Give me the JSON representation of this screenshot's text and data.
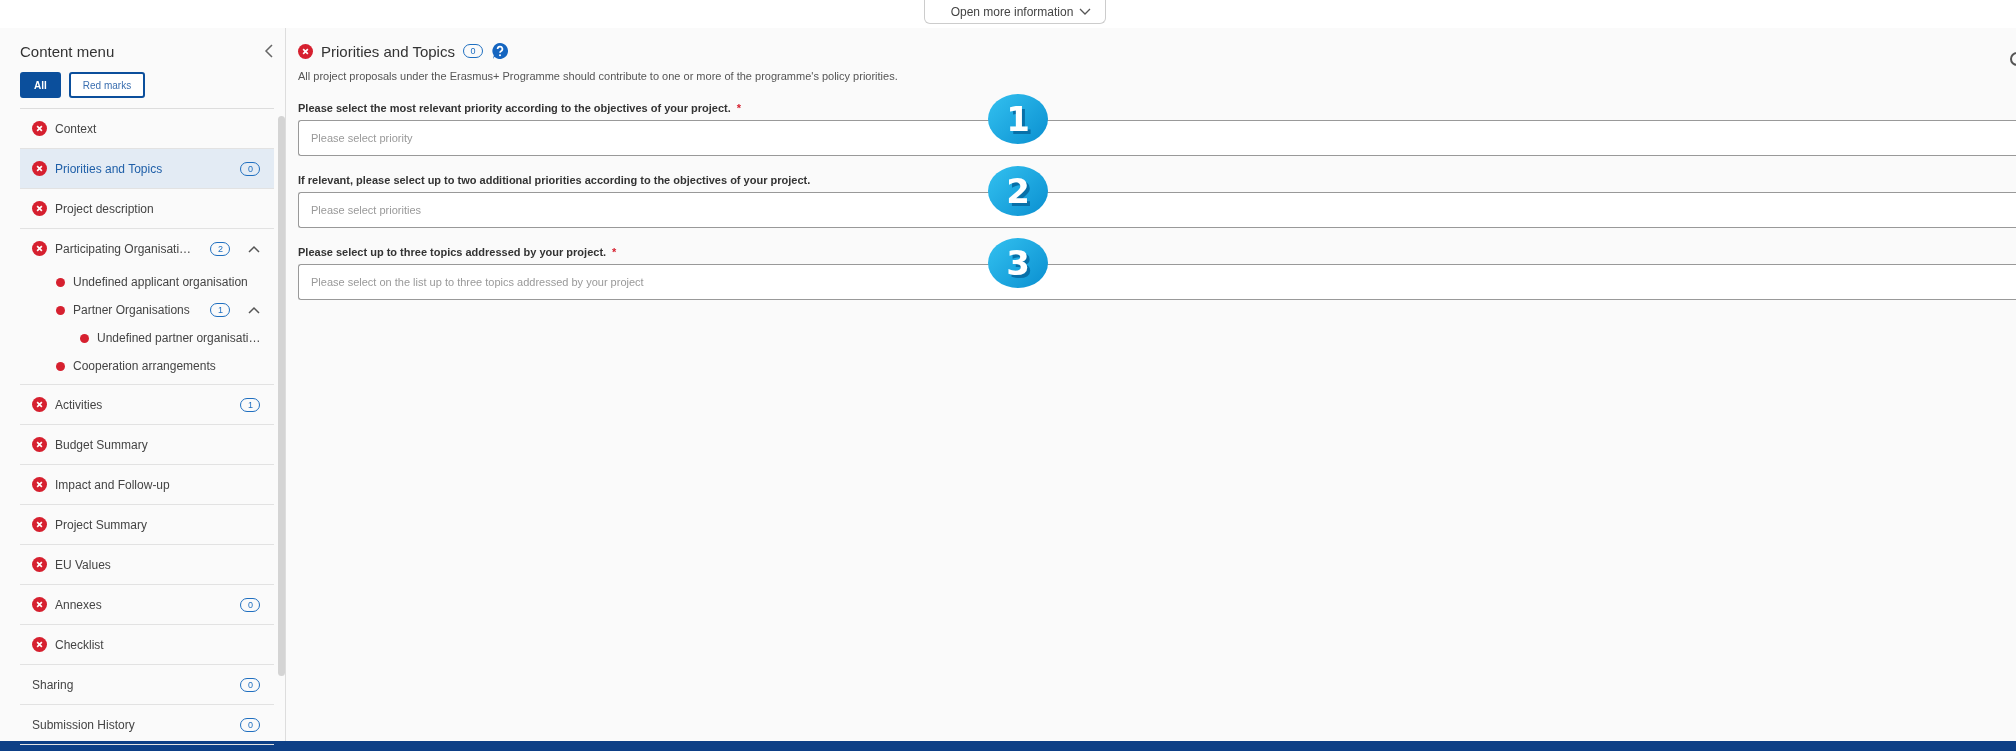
{
  "info_toggle": {
    "label": "Open more information",
    "expanded": false
  },
  "sidebar": {
    "title": "Content menu",
    "filters": [
      {
        "label": "All",
        "selected": true
      },
      {
        "label": "Red marks",
        "selected": false
      }
    ],
    "items": [
      {
        "label": "Context",
        "error": true,
        "selected": false
      },
      {
        "label": "Priorities and Topics",
        "error": true,
        "selected": true,
        "count": "0"
      },
      {
        "label": "Project description",
        "error": true,
        "selected": false
      },
      {
        "label": "Participating Organisati…",
        "error": true,
        "selected": false,
        "count": "2",
        "expanded": true,
        "children": [
          {
            "label": "Undefined applicant organisation",
            "error": true,
            "selected": false
          },
          {
            "label": "Partner Organisations",
            "error": true,
            "selected": false,
            "count": "1",
            "expanded": true,
            "children": [
              {
                "label": "Undefined partner organisati…",
                "error": true,
                "selected": false
              }
            ]
          },
          {
            "label": "Cooperation arrangements",
            "error": true,
            "selected": false
          }
        ]
      },
      {
        "label": "Activities",
        "error": true,
        "selected": false,
        "count": "1"
      },
      {
        "label": "Budget Summary",
        "error": true,
        "selected": false
      },
      {
        "label": "Impact and Follow-up",
        "error": true,
        "selected": false
      },
      {
        "label": "Project Summary",
        "error": true,
        "selected": false
      },
      {
        "label": "EU Values",
        "error": true,
        "selected": false
      },
      {
        "label": "Annexes",
        "error": true,
        "selected": false,
        "count": "0"
      },
      {
        "label": "Checklist",
        "error": true,
        "selected": false
      },
      {
        "label": "Sharing",
        "error": false,
        "selected": false,
        "count": "0"
      },
      {
        "label": "Submission History",
        "error": false,
        "selected": false,
        "count": "0"
      }
    ]
  },
  "section": {
    "title": "Priorities and Topics",
    "error": true,
    "count": "0",
    "description": "All project proposals under the Erasmus+ Programme should contribute to one or more of the programme's policy priorities.",
    "fields": [
      {
        "label": "Please select the most relevant priority according to the objectives of your project.",
        "required_mark": "*",
        "placeholder": "Please select priority",
        "marker": "1"
      },
      {
        "label": "If relevant, please select up to two additional priorities according to the objectives of your project.",
        "placeholder": "Please select priorities",
        "marker": "2"
      },
      {
        "label": "Please select up to three topics addressed by your project.",
        "required_mark": "*",
        "placeholder": "Please select on the list up to three topics addressed by your project",
        "marker": "3"
      }
    ]
  }
}
